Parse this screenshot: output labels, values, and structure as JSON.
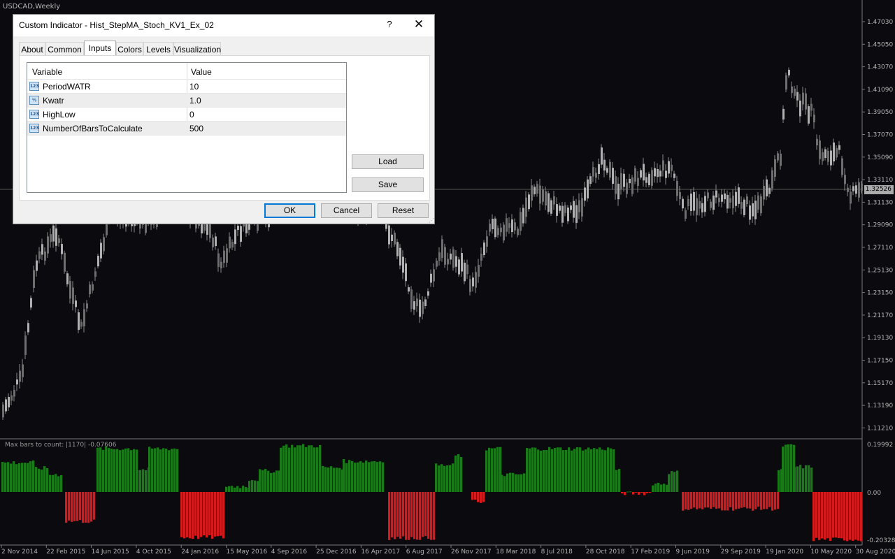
{
  "chart": {
    "symbol_label": "USDCAD,Weekly",
    "indicator_label": "Max bars to count: |1170|  -0.07606",
    "current_price": "1.32526",
    "price_axis": [
      "1.47030",
      "1.45050",
      "1.43070",
      "1.41090",
      "1.39050",
      "1.37070",
      "1.35090",
      "1.33110",
      "1.31130",
      "1.29090",
      "1.27110",
      "1.25130",
      "1.23150",
      "1.21170",
      "1.19130",
      "1.17150",
      "1.15170",
      "1.13190",
      "1.11210"
    ],
    "indicator_axis": [
      "0.19992",
      "0.00",
      "-0.20328"
    ],
    "time_axis": [
      "2 Nov 2014",
      "22 Feb 2015",
      "14 Jun 2015",
      "4 Oct 2015",
      "24 Jan 2016",
      "15 May 2016",
      "4 Sep 2016",
      "25 Dec 2016",
      "16 Apr 2017",
      "6 Aug 2017",
      "26 Nov 2017",
      "18 Mar 2018",
      "8 Jul 2018",
      "28 Oct 2018",
      "17 Feb 2019",
      "9 Jun 2019",
      "29 Sep 2019",
      "19 Jan 2020",
      "10 May 2020",
      "30 Aug 2020"
    ],
    "colors": {
      "background": "#0a0a0f",
      "candle": "#8a8a8a",
      "hist_up": "#1a7a1a",
      "hist_down": "#d41a1a",
      "axis_text": "#b4b4b4"
    }
  },
  "dialog": {
    "title": "Custom Indicator - Hist_StepMA_Stoch_KV1_Ex_02",
    "help_glyph": "?",
    "close_glyph": "✕",
    "tabs": [
      "About",
      "Common",
      "Inputs",
      "Colors",
      "Levels",
      "Visualization"
    ],
    "active_tab": "Inputs",
    "columns": {
      "variable": "Variable",
      "value": "Value"
    },
    "params": [
      {
        "icon": "123",
        "name": "PeriodWATR",
        "value": "10"
      },
      {
        "icon": "½",
        "name": "Kwatr",
        "value": "1.0"
      },
      {
        "icon": "123",
        "name": "HighLow",
        "value": "0"
      },
      {
        "icon": "123",
        "name": "NumberOfBarsToCalculate",
        "value": "500"
      }
    ],
    "buttons": {
      "load": "Load",
      "save": "Save",
      "ok": "OK",
      "cancel": "Cancel",
      "reset": "Reset"
    }
  }
}
